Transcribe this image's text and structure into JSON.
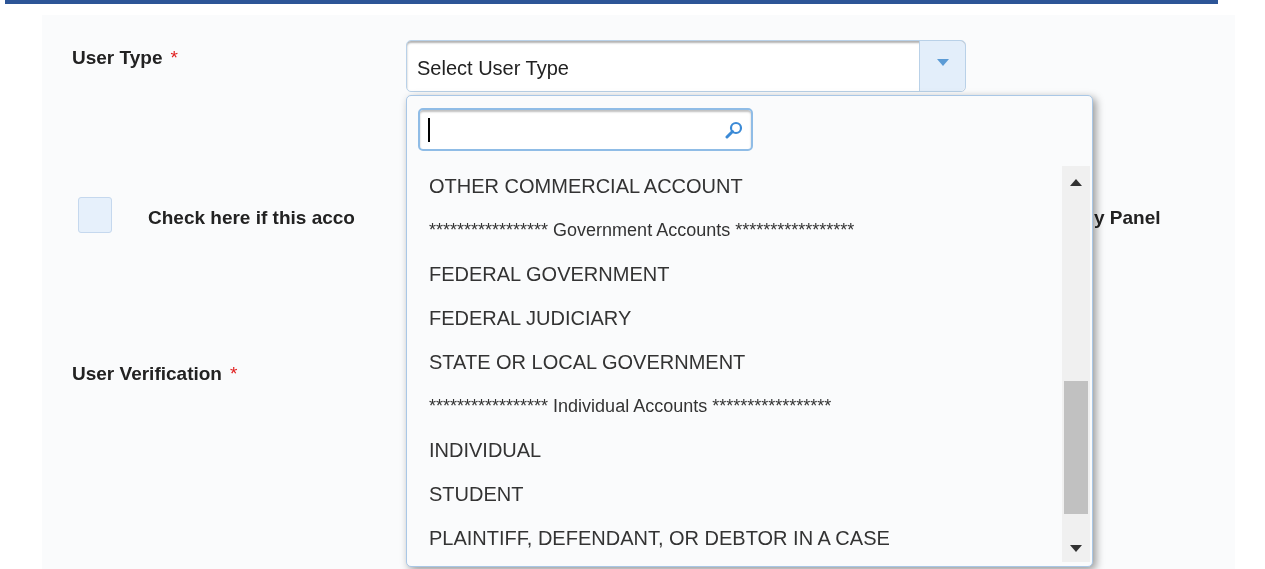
{
  "form": {
    "user_type": {
      "label": "User Type",
      "required_mark": "*",
      "placeholder": "Select User Type"
    },
    "checkbox": {
      "checked": false,
      "label_start": "Check here if this acco",
      "label_end": "y Panel"
    },
    "user_verification": {
      "label": "User Verification",
      "required_mark": "*"
    }
  },
  "dropdown": {
    "items": [
      {
        "kind": "option",
        "text": "OTHER COMMERCIAL ACCOUNT"
      },
      {
        "kind": "header",
        "text": "***************** Government Accounts *****************"
      },
      {
        "kind": "option",
        "text": "FEDERAL GOVERNMENT"
      },
      {
        "kind": "option",
        "text": "FEDERAL JUDICIARY"
      },
      {
        "kind": "option",
        "text": "STATE OR LOCAL GOVERNMENT"
      },
      {
        "kind": "header",
        "text": "***************** Individual Accounts *****************"
      },
      {
        "kind": "option",
        "text": "INDIVIDUAL"
      },
      {
        "kind": "option",
        "text": "STUDENT"
      },
      {
        "kind": "option",
        "text": "PLAINTIFF, DEFENDANT, OR DEBTOR IN A CASE"
      }
    ]
  }
}
